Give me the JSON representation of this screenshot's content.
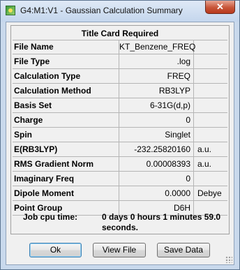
{
  "window": {
    "title": "G4:M1:V1 - Gaussian Calculation Summary",
    "close_label": "✕"
  },
  "summary": {
    "header": "Title Card Required",
    "rows": [
      {
        "label": "File Name",
        "value": "KT_Benzene_FREQ",
        "unit": ""
      },
      {
        "label": "File Type",
        "value": ".log",
        "unit": ""
      },
      {
        "label": "Calculation Type",
        "value": "FREQ",
        "unit": ""
      },
      {
        "label": "Calculation Method",
        "value": "RB3LYP",
        "unit": ""
      },
      {
        "label": "Basis Set",
        "value": "6-31G(d,p)",
        "unit": ""
      },
      {
        "label": "Charge",
        "value": "0",
        "unit": ""
      },
      {
        "label": "Spin",
        "value": "Singlet",
        "unit": ""
      },
      {
        "label": "E(RB3LYP)",
        "value": "-232.25820160",
        "unit": "a.u."
      },
      {
        "label": "RMS Gradient Norm",
        "value": "0.00008393",
        "unit": "a.u."
      },
      {
        "label": "Imaginary Freq",
        "value": "0",
        "unit": ""
      },
      {
        "label": "Dipole Moment",
        "value": "0.0000",
        "unit": "Debye"
      },
      {
        "label": "Point Group",
        "value": "D6H",
        "unit": ""
      }
    ],
    "job_label": "Job cpu time:",
    "job_value": "0 days  0 hours  1 minutes 59.0 seconds."
  },
  "buttons": {
    "ok": "Ok",
    "view_file": "View File",
    "save_data": "Save Data"
  }
}
